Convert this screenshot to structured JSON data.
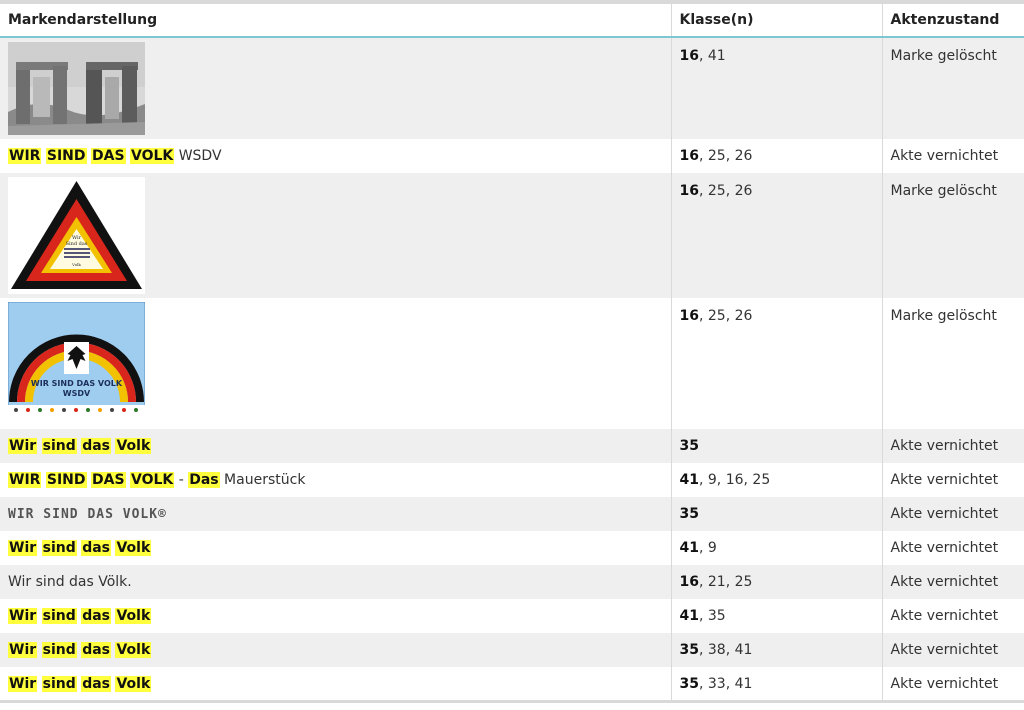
{
  "headers": {
    "mark": "Markendarstellung",
    "classes": "Klasse(n)",
    "status": "Aktenzustand"
  },
  "rows": [
    {
      "type": "image",
      "image": "stone-monument",
      "classes_main": "16",
      "classes_rest": ", 41",
      "status": "Marke gelöscht"
    },
    {
      "type": "text",
      "parts": [
        {
          "t": "WIR",
          "hl": true
        },
        {
          "t": " "
        },
        {
          "t": "SIND",
          "hl": true
        },
        {
          "t": " "
        },
        {
          "t": "DAS",
          "hl": true
        },
        {
          "t": " "
        },
        {
          "t": "VOLK",
          "hl": true
        },
        {
          "t": " WSDV"
        }
      ],
      "classes_main": "16",
      "classes_rest": ", 25, 26",
      "status": "Akte vernichtet"
    },
    {
      "type": "image",
      "image": "triangle-logo",
      "img_text": [
        "Wir",
        "Sind das",
        "Volk"
      ],
      "classes_main": "16",
      "classes_rest": ", 25, 26",
      "status": "Marke gelöscht"
    },
    {
      "type": "image",
      "image": "rainbow-eagle-logo",
      "img_text": [
        "WIR SIND DAS VOLK",
        "WSDV"
      ],
      "classes_main": "16",
      "classes_rest": ", 25, 26",
      "status": "Marke gelöscht"
    },
    {
      "type": "text",
      "parts": [
        {
          "t": "Wir",
          "hl": true
        },
        {
          "t": " "
        },
        {
          "t": "sind",
          "hl": true
        },
        {
          "t": " "
        },
        {
          "t": "das",
          "hl": true
        },
        {
          "t": " "
        },
        {
          "t": "Volk",
          "hl": true
        }
      ],
      "classes_main": "35",
      "classes_rest": "",
      "status": "Akte vernichtet"
    },
    {
      "type": "text",
      "parts": [
        {
          "t": "WIR",
          "hl": true
        },
        {
          "t": " "
        },
        {
          "t": "SIND",
          "hl": true
        },
        {
          "t": " "
        },
        {
          "t": "DAS",
          "hl": true
        },
        {
          "t": " "
        },
        {
          "t": "VOLK",
          "hl": true
        },
        {
          "t": " - "
        },
        {
          "t": "Das",
          "hl": true
        },
        {
          "t": " Mauerstück"
        }
      ],
      "classes_main": "41",
      "classes_rest": ", 9, 16, 25",
      "status": "Akte vernichtet"
    },
    {
      "type": "stylized",
      "text": "WIR SIND DAS VOLK®",
      "classes_main": "35",
      "classes_rest": "",
      "status": "Akte vernichtet"
    },
    {
      "type": "text",
      "parts": [
        {
          "t": "Wir",
          "hl": true
        },
        {
          "t": " "
        },
        {
          "t": "sind",
          "hl": true
        },
        {
          "t": " "
        },
        {
          "t": "das",
          "hl": true
        },
        {
          "t": " "
        },
        {
          "t": "Volk",
          "hl": true
        }
      ],
      "classes_main": "41",
      "classes_rest": ", 9",
      "status": "Akte vernichtet"
    },
    {
      "type": "text",
      "parts": [
        {
          "t": "Wir sind das Völk."
        }
      ],
      "classes_main": "16",
      "classes_rest": ", 21, 25",
      "status": "Akte vernichtet"
    },
    {
      "type": "text",
      "parts": [
        {
          "t": "Wir",
          "hl": true
        },
        {
          "t": " "
        },
        {
          "t": "sind",
          "hl": true
        },
        {
          "t": " "
        },
        {
          "t": "das",
          "hl": true
        },
        {
          "t": " "
        },
        {
          "t": "Volk",
          "hl": true
        }
      ],
      "classes_main": "41",
      "classes_rest": ", 35",
      "status": "Akte vernichtet"
    },
    {
      "type": "text",
      "parts": [
        {
          "t": "Wir",
          "hl": true
        },
        {
          "t": " "
        },
        {
          "t": "sind",
          "hl": true
        },
        {
          "t": " "
        },
        {
          "t": "das",
          "hl": true
        },
        {
          "t": " "
        },
        {
          "t": "Volk",
          "hl": true
        }
      ],
      "classes_main": "35",
      "classes_rest": ", 38, 41",
      "status": "Akte vernichtet"
    },
    {
      "type": "text",
      "parts": [
        {
          "t": "Wir",
          "hl": true
        },
        {
          "t": " "
        },
        {
          "t": "sind",
          "hl": true
        },
        {
          "t": " "
        },
        {
          "t": "das",
          "hl": true
        },
        {
          "t": " "
        },
        {
          "t": "Volk",
          "hl": true
        }
      ],
      "classes_main": "35",
      "classes_rest": ", 33, 41",
      "status": "Akte vernichtet"
    }
  ]
}
